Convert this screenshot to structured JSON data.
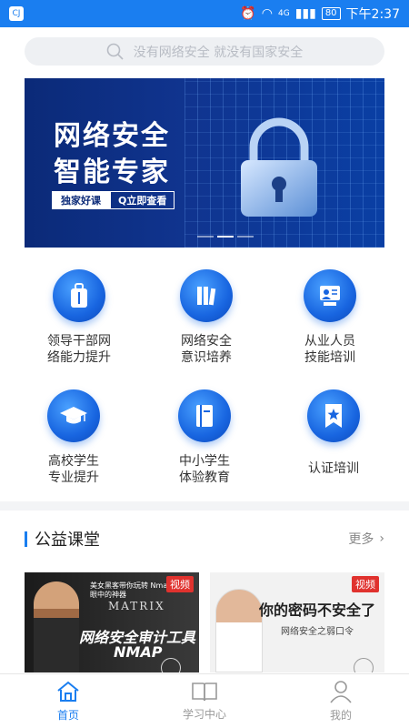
{
  "status_bar": {
    "app_badge": "CJ",
    "battery": "80",
    "time": "下午2:37",
    "signal": "4G"
  },
  "search": {
    "placeholder": "没有网络安全 就没有国家安全"
  },
  "banner": {
    "line1": "网络安全",
    "line2": "智能专家",
    "tag1": "独家好课",
    "tag2": "Q立即查看",
    "active_dot": 2
  },
  "menu": [
    {
      "label": "领导干部网\n络能力提升",
      "icon": "luggage-icon"
    },
    {
      "label": "网络安全\n意识培养",
      "icon": "books-icon"
    },
    {
      "label": "从业人员\n技能培训",
      "icon": "presenter-icon"
    },
    {
      "label": "高校学生\n专业提升",
      "icon": "graduation-cap-icon"
    },
    {
      "label": "中小学生\n体验教育",
      "icon": "book-icon"
    },
    {
      "label": "认证培训",
      "icon": "bookmark-star-icon"
    }
  ],
  "section": {
    "title": "公益课堂",
    "more": "更多"
  },
  "courses": [
    {
      "tag": "视频",
      "subtitle": "美女黑客带你玩转 Nmap 黑客眼中的神器",
      "brand": "MATRIX",
      "line1": "网络安全审计工具",
      "line2": "NMAP"
    },
    {
      "tag": "视频",
      "title": "你的密码不安全了",
      "subtitle": "网络安全之弱口令"
    }
  ],
  "tabs": [
    {
      "label": "首页",
      "icon": "home-icon",
      "active": true
    },
    {
      "label": "学习中心",
      "icon": "open-book-icon",
      "active": false
    },
    {
      "label": "我的",
      "icon": "person-icon",
      "active": false
    }
  ],
  "colors": {
    "primary": "#1a7ef0",
    "banner_dark": "#0b2a78",
    "video_tag": "#e0322e"
  }
}
